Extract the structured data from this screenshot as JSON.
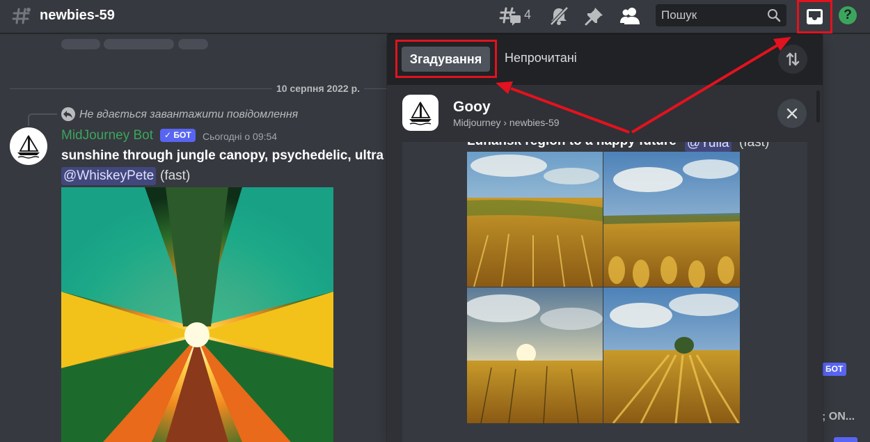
{
  "header": {
    "channel_name": "newbies-59",
    "thread_count": "4",
    "search_placeholder": "Пошук",
    "help_label": "?"
  },
  "chat": {
    "date_divider": "10 серпня 2022 р.",
    "reply_text": "Не вдається завантажити повідомлення",
    "author": "MidJourney Bot",
    "bot_tag": "✓ БОТ",
    "timestamp": "Сьогодні о 09:54",
    "message_text": "sunshine through jungle canopy, psychedelic, ultra re",
    "mention": "@WhiskeyPete",
    "mode": "(fast)",
    "right_bot_tag": "БОТ",
    "right_text": "; ON..."
  },
  "inbox": {
    "tabs": [
      {
        "label": "Згадування",
        "active": true
      },
      {
        "label": "Непрочитані",
        "active": false
      }
    ],
    "server_name": "Gooy",
    "server_path": "Midjourney › newbies-59",
    "cut_text": "Luhansk region to a happy future",
    "cut_mention": "@Yulia",
    "cut_mode": "(fast)"
  },
  "icons": {
    "hash": "hash-icon",
    "threads": "threads-icon",
    "mute": "bell-slash-icon",
    "pin": "pin-icon",
    "members": "members-icon",
    "search": "search-icon",
    "inbox": "inbox-icon",
    "help": "help-icon",
    "sort": "sort-icon",
    "close": "close-icon",
    "reply": "reply-icon"
  },
  "colors": {
    "accent": "#5865f2",
    "highlight": "#e3121e",
    "online": "#3ba55d",
    "bg": "#36393f",
    "panel": "#2f3136",
    "header": "#202225"
  }
}
